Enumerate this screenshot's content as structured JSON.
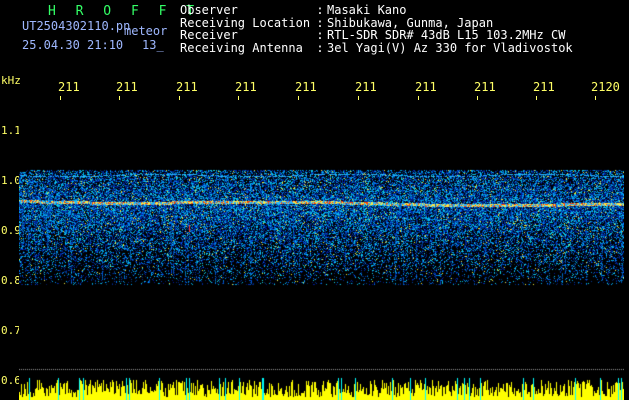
{
  "header": {
    "app_title": "H R O F F T",
    "file_name": "UT2504302110.pn",
    "meteor_label": "meteor",
    "datetime": "25.04.30 21:10",
    "frame_count": "13_"
  },
  "meta": {
    "rows": [
      {
        "label": "Observer",
        "colon": ":",
        "value": "Masaki Kano"
      },
      {
        "label": "Receiving Location",
        "colon": ":",
        "value": "Shibukawa, Gunma, Japan"
      },
      {
        "label": "Receiver",
        "colon": ":",
        "value": "RTL-SDR SDR# 43dB L15 103.2MHz CW"
      },
      {
        "label": "Receiving Antenna",
        "colon": ":",
        "value": "3el Yagi(V) Az 330 for Vladivostok"
      }
    ]
  },
  "axis": {
    "unit": "kHz",
    "y_ticks": [
      "1.1",
      "1.0",
      "0.9",
      "0.8",
      "0.7",
      "0.6"
    ],
    "time_ticks": [
      "211",
      "211",
      "211",
      "211",
      "211",
      "211",
      "211",
      "211",
      "211",
      "2120"
    ]
  },
  "colors": {
    "background": "#000000",
    "tick_color": "#ffff66",
    "title_green": "#33ff66",
    "file_blue": "#9fb8ff",
    "meta_white": "#ffffff",
    "spectrogram_low": "#001a99",
    "spectrogram_mid": "#1f7bff",
    "spectrogram_high": "#ffeb3b",
    "spectrogram_peak": "#ff3300",
    "signal_bar": "#ffff00"
  }
}
